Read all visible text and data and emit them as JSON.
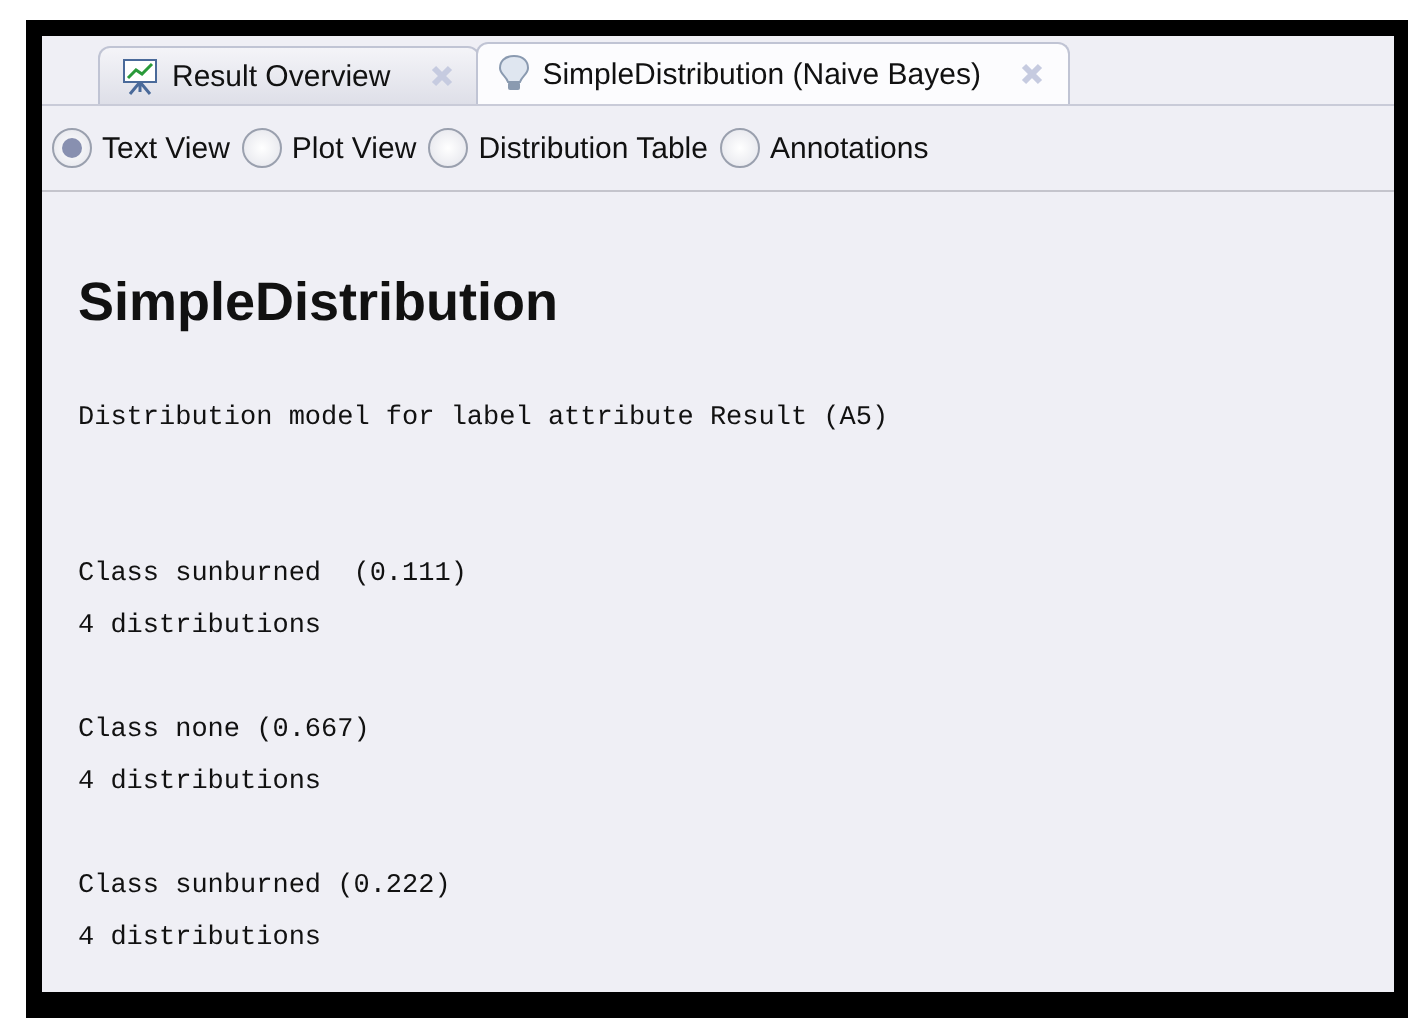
{
  "tabs": [
    {
      "label": "Result Overview",
      "kind": "overview",
      "selected": false
    },
    {
      "label": "SimpleDistribution (Naive Bayes)",
      "kind": "model",
      "selected": true
    }
  ],
  "views": [
    {
      "label": "Text View",
      "selected": true
    },
    {
      "label": "Plot View",
      "selected": false
    },
    {
      "label": "Distribution Table",
      "selected": false
    },
    {
      "label": "Annotations",
      "selected": false
    }
  ],
  "title": "SimpleDistribution",
  "summary": "Distribution model for label attribute Result (A5)",
  "classes": [
    {
      "heading": "Class sunburned  (0.111)",
      "detail": "4 distributions"
    },
    {
      "heading": "Class none (0.667)",
      "detail": "4 distributions"
    },
    {
      "heading": "Class sunburned (0.222)",
      "detail": "4 distributions"
    }
  ]
}
